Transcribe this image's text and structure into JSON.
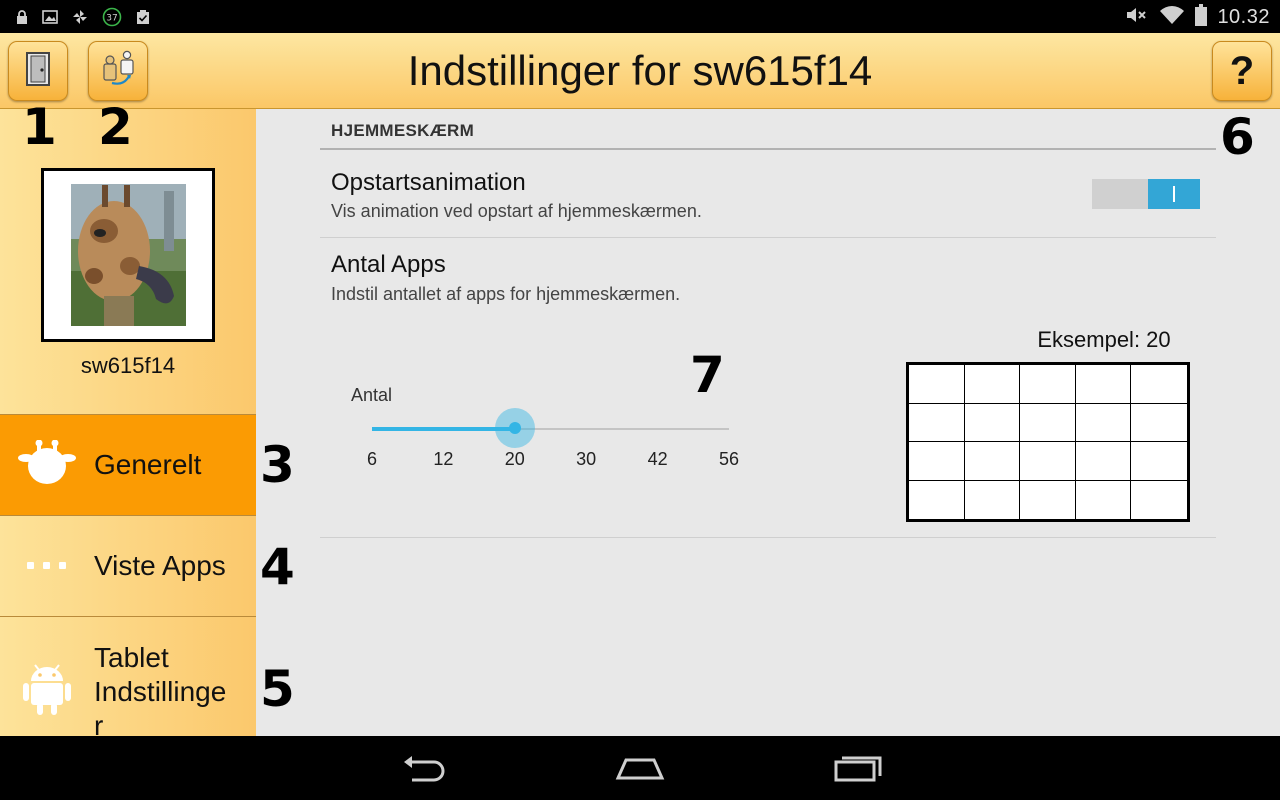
{
  "status_bar": {
    "time": "10.32",
    "notification_badge": "37",
    "icons_left": [
      "lock-icon",
      "image-icon",
      "pinwheel-icon",
      "badge-37-icon",
      "clipboard-check-icon"
    ],
    "icons_right": [
      "mute-icon",
      "wifi-icon",
      "battery-icon"
    ]
  },
  "action_bar": {
    "title": "Indstillinger for sw615f14",
    "exit_icon": "door-icon",
    "switch_profile_icon": "switch-profile-icon",
    "help_label": "?"
  },
  "callouts": {
    "one": "1",
    "two": "2",
    "three": "3",
    "four": "4",
    "five": "5",
    "six": "6",
    "seven": "7"
  },
  "profile": {
    "name": "sw615f14"
  },
  "sidebar": {
    "items": [
      {
        "label": "Generelt",
        "icon": "giraffe-head-icon",
        "active": true
      },
      {
        "label": "Viste Apps",
        "icon": "dots-icon",
        "active": false
      },
      {
        "label": "Tablet Indstillinge r",
        "label_lines": [
          "Tablet",
          "Indstillinge",
          "r"
        ],
        "icon": "android-icon",
        "active": false
      }
    ]
  },
  "content": {
    "section_title": "HJEMMESKÆRM",
    "startup": {
      "title": "Opstartsanimation",
      "summary": "Vis animation ved opstart af hjemmeskærmen.",
      "toggle_on": true
    },
    "apps": {
      "title": "Antal Apps",
      "summary": "Indstil antallet af apps for hjemmeskærmen.",
      "slider_label": "Antal",
      "ticks": [
        "6",
        "12",
        "20",
        "30",
        "42",
        "56"
      ],
      "selected_value": "20",
      "selected_index": 2,
      "example_label": "Eksempel: 20",
      "example_grid": {
        "columns": 5,
        "rows": 4
      }
    }
  },
  "colors": {
    "accent_orange": "#fb9b03",
    "slider_blue": "#33b5e5",
    "toggle_blue": "#33a6d6"
  }
}
